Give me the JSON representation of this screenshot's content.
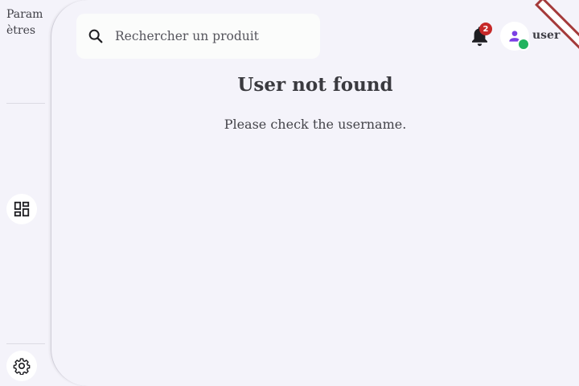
{
  "sidebar": {
    "label": "Paramètres",
    "icons": {
      "dashboard": "dashboard-icon",
      "settings": "gear-icon"
    }
  },
  "search": {
    "placeholder": "Rechercher un produit",
    "value": ""
  },
  "header": {
    "notification_count": "2",
    "username": "user"
  },
  "content": {
    "title": "User not found",
    "message": "Please check the username."
  },
  "colors": {
    "background": "#f4f3fa",
    "badge": "#c62828",
    "online": "#22b35e",
    "avatar_icon": "#7b3fe4",
    "ribbon": "#a43a3a"
  }
}
